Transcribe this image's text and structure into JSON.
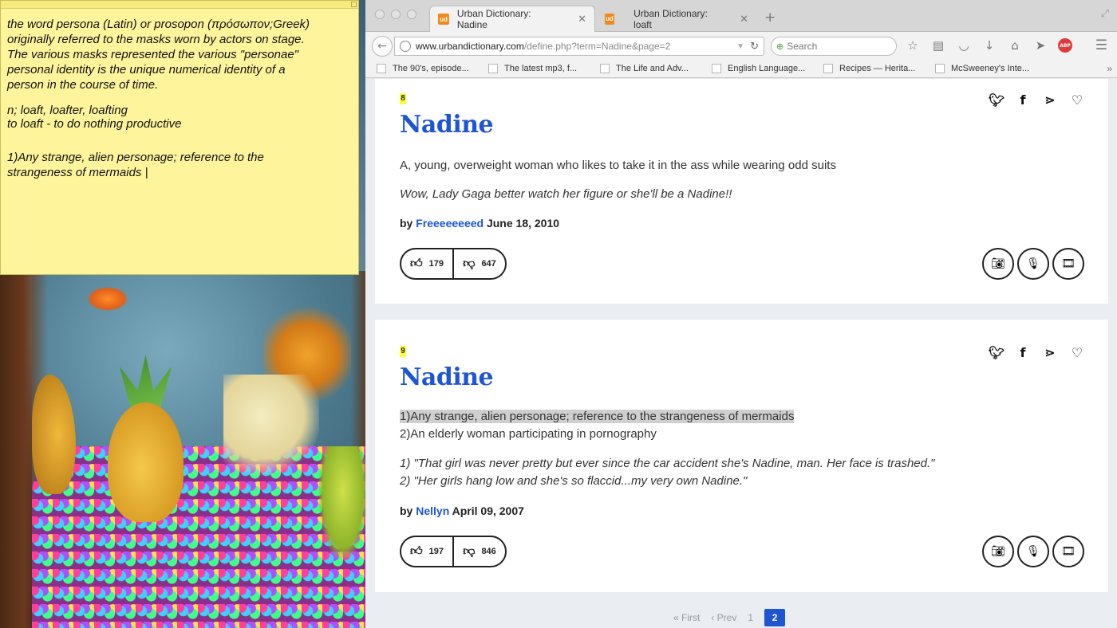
{
  "sticky_note": {
    "paragraphs": [
      [
        "the word persona (Latin) or prosopon (πρόσωπον;Greek)",
        "originally referred to the masks worn by actors on stage.",
        "The various masks represented the various \"personae\"",
        "personal identity is the unique numerical identity of a",
        "person in the course of time."
      ],
      [
        "n; loaft, loafter, loafting",
        "to loaft - to do nothing productive"
      ],
      [
        "1)Any strange, alien personage; reference to the",
        "strangeness of mermaids |"
      ]
    ]
  },
  "browser": {
    "tabs": [
      {
        "favicon": "ud",
        "label": "Urban Dictionary: Nadine",
        "close": "✕",
        "active": true
      },
      {
        "favicon": "ud",
        "label": "Urban Dictionary: loaft",
        "close": "✕",
        "active": false
      }
    ],
    "new_tab": "+",
    "url": {
      "host": "www.urbandictionary.com",
      "path": "/define.php?term=Nadine&page=2"
    },
    "search_placeholder": "Search",
    "bookmarks": [
      "The 90's, episode...",
      "The latest mp3, f...",
      "The Life and Adv...",
      "English Language...",
      "Recipes — Herita...",
      "McSweeney's Inte..."
    ],
    "bookmarks_more": "»",
    "icons": {
      "abp_label": "ABP",
      "abp_color": "#e03a3a"
    }
  },
  "page": {
    "accent_color": "#1d55d4",
    "definitions": [
      {
        "rank": "8",
        "word": "Nadine",
        "meaning": [
          "A, young, overweight woman who likes to take it in the ass while wearing odd suits"
        ],
        "example": [
          "Wow, Lady Gaga better watch her figure or she'll be a Nadine!!"
        ],
        "by": "by",
        "author": "Freeeeeeeed",
        "date": "June 18, 2010",
        "upvotes": "179",
        "downvotes": "647"
      },
      {
        "rank": "9",
        "word": "Nadine",
        "meaning": [
          "1)Any strange, alien personage; reference to the strangeness of mermaids",
          "2)An elderly woman participating in pornography"
        ],
        "example": [
          "1) \"That girl was never pretty but ever since the car accident she's Nadine, man. Her face is trashed.\"",
          "2) \"Her girls hang low and she's so flaccid...my very own Nadine.\""
        ],
        "by": "by",
        "author": "Nellyn",
        "date": "April 09, 2007",
        "upvotes": "197",
        "downvotes": "846"
      }
    ],
    "pagination": {
      "first": "« First",
      "prev": "‹ Prev",
      "pages": [
        "1",
        "2"
      ],
      "current": "2"
    }
  }
}
